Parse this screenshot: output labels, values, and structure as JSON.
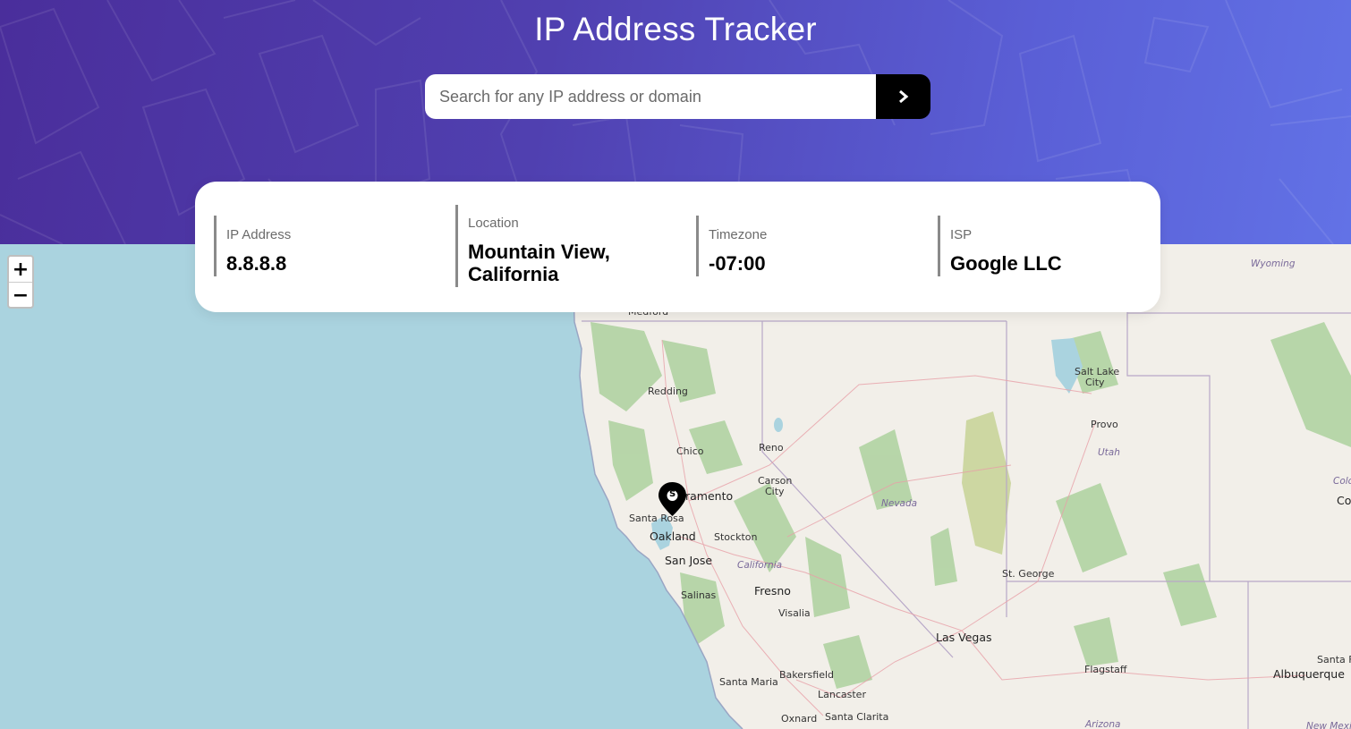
{
  "header": {
    "title": "IP Address Tracker"
  },
  "search": {
    "placeholder": "Search for any IP address or domain",
    "value": "",
    "submit_icon": "chevron-right-icon"
  },
  "info": {
    "ip": {
      "label": "IP Address",
      "value": "8.8.8.8"
    },
    "location": {
      "label": "Location",
      "value": "Mountain View, California"
    },
    "timezone": {
      "label": "Timezone",
      "value": "-07:00"
    },
    "isp": {
      "label": "ISP",
      "value": "Google LLC"
    }
  },
  "map": {
    "zoom_in_label": "+",
    "zoom_out_label": "−",
    "marker_icon": "location-pin-icon",
    "marker_glyph": "S",
    "labels": {
      "medford": "Medford",
      "redding": "Redding",
      "chico": "Chico",
      "reno": "Reno",
      "carson_city_1": "Carson",
      "carson_city_2": "City",
      "sacramento": "ramento",
      "santa_rosa": "Santa Rosa",
      "oakland": "Oakland",
      "stockton": "Stockton",
      "san_jose": "San Jose",
      "california": "California",
      "salinas": "Salinas",
      "fresno": "Fresno",
      "visalia": "Visalia",
      "bakersfield": "Bakersfield",
      "santa_maria": "Santa Maria",
      "lancaster": "Lancaster",
      "oxnard": "Oxnard",
      "santa_clarita": "Santa Clarita",
      "nevada": "Nevada",
      "las_vegas": "Las Vegas",
      "st_george": "St. George",
      "utah": "Utah",
      "provo": "Provo",
      "salt_lake_1": "Salt Lake",
      "salt_lake_2": "City",
      "wyoming": "Wyoming",
      "flagstaff": "Flagstaff",
      "albuquerque": "Albuquerque",
      "santa_fe": "Santa Fe",
      "arizona": "Arizona",
      "new_mexico": "New Mexico",
      "colo": "Colo",
      "co": "Co"
    }
  },
  "colors": {
    "header_gradient_start": "#4a2e9b",
    "header_gradient_end": "#6272e6",
    "ocean": "#aad3df",
    "land": "#f2efe9",
    "forest": "#add19e",
    "button": "#000000"
  }
}
